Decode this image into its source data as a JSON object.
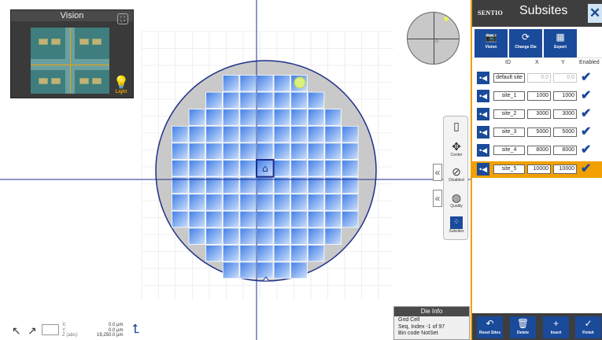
{
  "vision": {
    "title": "Vision",
    "light_label": "Light"
  },
  "tools": {
    "center_label": "Center",
    "disabled_label": "Disabled",
    "quality_label": "Quality",
    "subsites_label": "Subsites"
  },
  "readout": {
    "x_label": "X:",
    "y_label": "Y:",
    "z_label": "Z (abs):",
    "x_value": "0.0  µm",
    "y_value": "0.0  µm",
    "z_value": "19,250.0  µm"
  },
  "die_info": {
    "title": "Die Info",
    "grid_cell": "Grid Cell",
    "seq_index": "Seq, Index  -1   of  97",
    "bin_code": "Bin code    NotSet"
  },
  "panel": {
    "logo": "SENTIO",
    "title": "Subsites",
    "close_glyph": "✕",
    "toolbar": [
      {
        "label": "Vision",
        "icon": "camera-icon"
      },
      {
        "label": "Change Die",
        "icon": "change-die-icon"
      },
      {
        "label": "Export",
        "icon": "export-icon"
      }
    ],
    "columns": {
      "id": "ID",
      "x": "X",
      "y": "Y",
      "enabled": "Enabled"
    },
    "sites": [
      {
        "id": "default site",
        "x": "0.0",
        "y": "0.0",
        "enabled": true,
        "readonly": true,
        "selected": false
      },
      {
        "id": "site_1",
        "x": "1000",
        "y": "1000",
        "enabled": true,
        "readonly": false,
        "selected": false
      },
      {
        "id": "site_2",
        "x": "3000",
        "y": "3000",
        "enabled": true,
        "readonly": false,
        "selected": false
      },
      {
        "id": "site_3",
        "x": "5000",
        "y": "5000",
        "enabled": true,
        "readonly": false,
        "selected": false
      },
      {
        "id": "site_4",
        "x": "8000",
        "y": "8000",
        "enabled": true,
        "readonly": false,
        "selected": false
      },
      {
        "id": "site_5",
        "x": "10000",
        "y": "10000",
        "enabled": true,
        "readonly": false,
        "selected": true
      }
    ],
    "footer": [
      {
        "label": "Reset Sites",
        "icon": "reset-icon"
      },
      {
        "label": "Delete",
        "icon": "trash-icon"
      },
      {
        "label": "Insert",
        "icon": "plus-icon"
      },
      {
        "label": "Finish",
        "icon": "check-icon"
      }
    ]
  },
  "colors": {
    "accent": "#f0a000",
    "primary": "#1a4a9a",
    "die": "#7aa8f0"
  },
  "wafer": {
    "row_die_counts": [
      5,
      7,
      9,
      11,
      11,
      11,
      11,
      11,
      11,
      9,
      7,
      5
    ]
  }
}
